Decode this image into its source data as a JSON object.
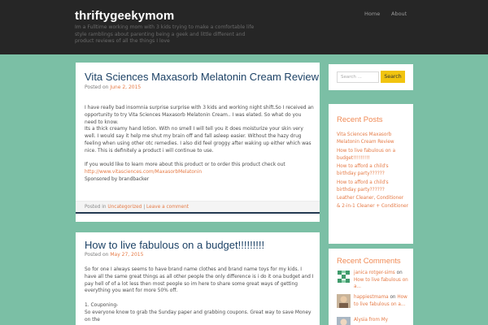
{
  "site": {
    "title": "thriftygeekymom",
    "description": "Im a Fulltime working mom with 3 kids trying to make a comfortable life style ramblings about parenting being a geek and little different and product reviews of all the things I love"
  },
  "nav": {
    "items": [
      "Home",
      "About"
    ]
  },
  "posts": [
    {
      "title": "Vita Sciences Maxasorb Melatonin Cream Review",
      "meta_prefix": "Posted on",
      "date": "June 2, 2015",
      "paragraphs": [
        "I have really bad insomnia surprise surprise with 3 kids and working night shift.So I received an opportunity to try Vita Sciences Maxasorb Melatonin Cream.. I was elated. So what do you need to know.",
        "Its a thick creamy hand lotion. With no smell I will tell you it does moisturize your skin very well. I would say it help me shut my brain off and fall asleep easier. Without the hazy drug feeling when using other otc remedies. I also did feel groggy after waking up either which was nice. This is definitely a product i will continue to use.",
        "If you would like to learn more about this product or to order this product check out"
      ],
      "link": "http://www.vitasciences.com/MaxasorbMelatonin",
      "sponsor": "Sponsored by brandbacker",
      "footer_prefix": "Posted in",
      "category": "Uncategorized",
      "footer_sep": " | ",
      "comment_link": "Leave a comment"
    },
    {
      "title": "How to live fabulous on a budget!!!!!!!!!",
      "meta_prefix": "Posted on",
      "date": "May 27, 2015",
      "paragraphs": [
        "So for one I always seems to have brand name clothes and brand name toys for my kids. I have all the same great things as all other people the only difference is i do it ona budget and I pay hell of of a lot less then most people so im here to share some great ways of getting everything you want for more 50% off.",
        "1. Couponing-",
        "So everyone know to grab the Sunday paper and grabbing coupons. Great way to save Money on the"
      ]
    }
  ],
  "sidebar": {
    "search": {
      "placeholder": "Search ...",
      "button": "Search"
    },
    "recent_posts": {
      "title": "Recent Posts",
      "items": [
        "Vita Sciences Maxasorb Melatonin Cream Review",
        "How to live fabulous on a budget!!!!!!!!!",
        "How to afford a child's birthday party??????",
        "How to afford a child's birthday party??????",
        "Leather Cleaner, Conditioner & 2-in-1 Cleaner + Conditioner"
      ]
    },
    "recent_comments": {
      "title": "Recent Comments",
      "items": [
        {
          "author": "janica rotger-sims",
          "on": "on",
          "post": "How to live fabulous on a..."
        },
        {
          "author": "happiestmama",
          "on": "on",
          "post": "How to live fabulous on a..."
        },
        {
          "author": "Alysia from My",
          "on": "",
          "post": ""
        }
      ]
    }
  },
  "colors": {
    "background": "#7bbfa5",
    "header": "#262626",
    "accent": "#e57a45",
    "title": "#1d4266",
    "search_button": "#f1c40f"
  }
}
